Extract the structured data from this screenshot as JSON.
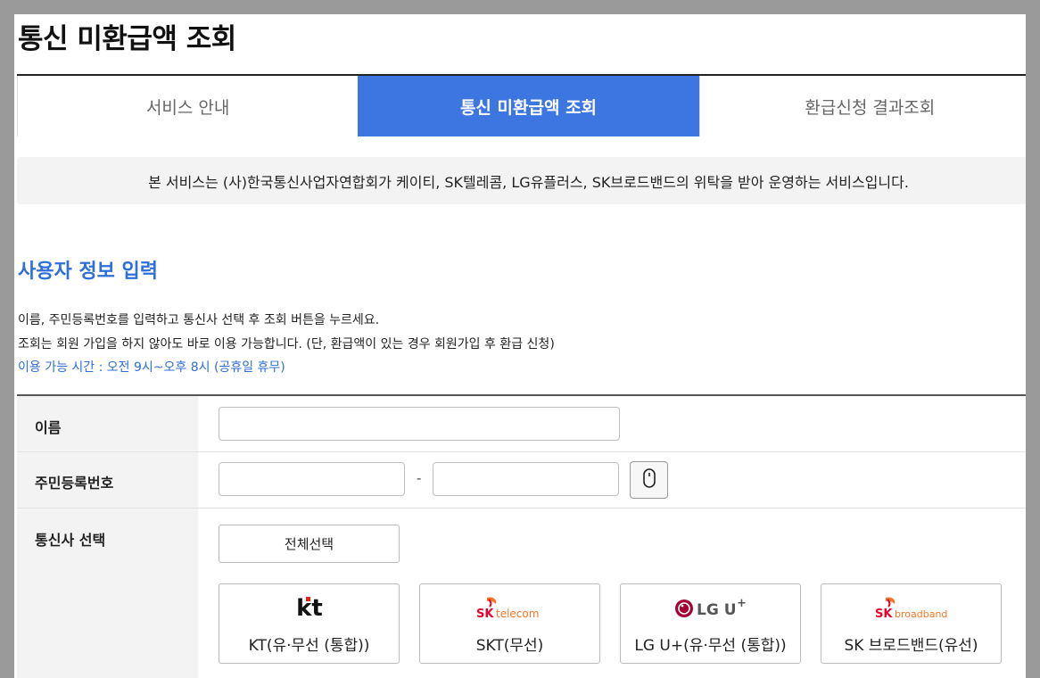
{
  "page_title": "통신 미환급액 조회",
  "tabs": [
    {
      "label": "서비스 안내",
      "active": false
    },
    {
      "label": "통신 미환급액 조회",
      "active": true
    },
    {
      "label": "환급신청 결과조회",
      "active": false
    }
  ],
  "notice": "본 서비스는 (사)한국통신사업자연합회가 케이티, SK텔레콤, LG유플러스, SK브로드밴드의 위탁을 받아 운영하는 서비스입니다.",
  "section_title": "사용자 정보 입력",
  "descriptions": [
    "이름, 주민등록번호를 입력하고 통신사 선택 후 조회 버튼을 누르세요.",
    "조회는 회원 가입을 하지 않아도 바로 이용 가능합니다. (단, 환급액이 있는 경우 회원가입 후 환급 신청)",
    "이용 가능 시간 : 오전 9시~오후 8시 (공휴일 휴무)"
  ],
  "form": {
    "name_label": "이름",
    "name_value": "",
    "rrn_label": "주민등록번호",
    "rrn_front_value": "",
    "rrn_separator": "-",
    "rrn_back_value": "",
    "carrier_label": "통신사 선택",
    "select_all": "전체선택",
    "carriers": [
      {
        "logo": "kt",
        "name": "KT(유·무선 (통합))"
      },
      {
        "logo": "SK telecom",
        "name": "SKT(무선)"
      },
      {
        "logo": "LG U+",
        "name": "LG U+(유·무선 (통합))"
      },
      {
        "logo": "SK broadband",
        "name": "SK 브로드밴드(유선)"
      }
    ]
  },
  "colors": {
    "accent": "#3d76e1",
    "section_title": "#2f6fd6",
    "kt_red": "#e1251b",
    "sk_red": "#ea002c",
    "sk_orange": "#f47725",
    "lg_red": "#a50034"
  },
  "icons": {
    "mouse_button": "mouse-icon"
  }
}
